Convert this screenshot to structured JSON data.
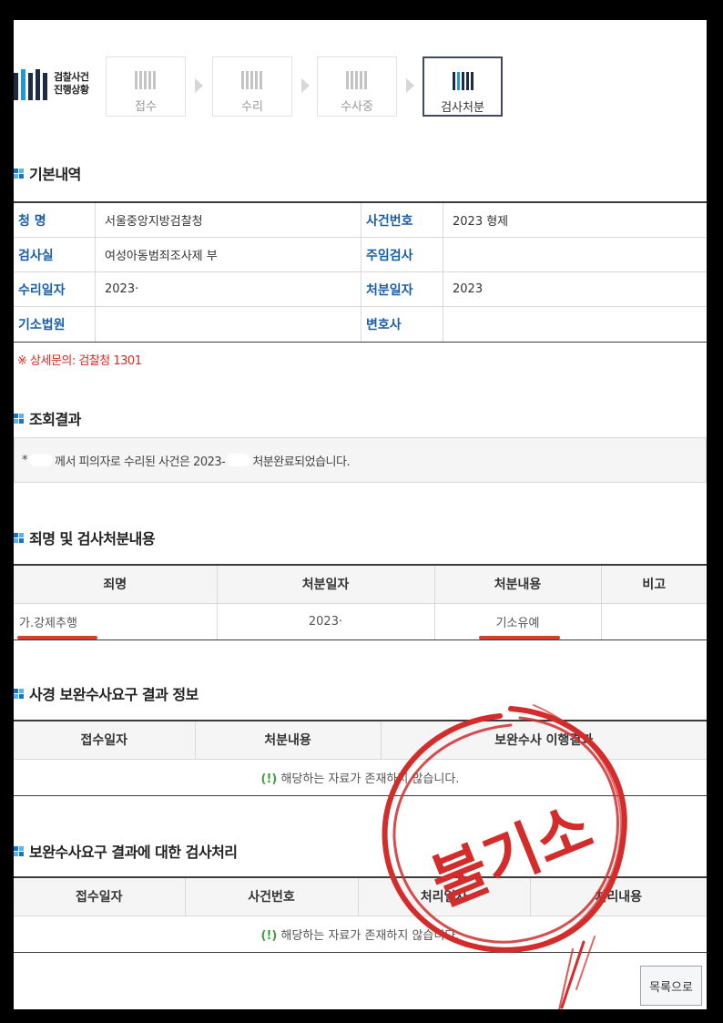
{
  "progress": {
    "logo_line1": "검찰사건",
    "logo_line2": "진행상황",
    "steps": [
      {
        "label": "접수",
        "active": false
      },
      {
        "label": "수리",
        "active": false
      },
      {
        "label": "수사중",
        "active": false
      },
      {
        "label": "검사처분",
        "active": true
      }
    ]
  },
  "basic": {
    "title": "기본내역",
    "rows": [
      {
        "k1": "청 명",
        "v1": "서울중앙지방검찰청",
        "k2": "사건번호",
        "v2": "2023 형제"
      },
      {
        "k1": "검사실",
        "v1": "여성아동범죄조사제 부",
        "k2": "주임검사",
        "v2": ""
      },
      {
        "k1": "수리일자",
        "v1": "2023·",
        "k2": "처분일자",
        "v2": "2023"
      },
      {
        "k1": "기소법원",
        "v1": "",
        "k2": "변호사",
        "v2": ""
      }
    ],
    "notice": "※ 상세문의: 검찰청 1301"
  },
  "inquiry": {
    "title": "조회결과",
    "prefix": "*",
    "text_a": "께서 피의자로 수리된 사건은 2023-",
    "text_b": "처분완료되었습니다."
  },
  "charges": {
    "title": "죄명 및 검사처분내용",
    "headers": [
      "죄명",
      "처분일자",
      "처분내용",
      "비고"
    ],
    "row": {
      "charge": "가.강제추행",
      "date": "2023·",
      "disposition": "기소유예",
      "note": ""
    }
  },
  "police": {
    "title": "사경 보완수사요구 결과 정보",
    "headers": [
      "접수일자",
      "처분내용",
      "보완수사 이행결과"
    ],
    "empty_mark": "(!)",
    "empty_text": "해당하는 자료가 존재하지 않습니다."
  },
  "prosecutor": {
    "title": "보완수사요구 결과에 대한 검사처리",
    "headers": [
      "접수일자",
      "사건번호",
      "처리일자",
      "처리내용"
    ],
    "empty_mark": "(!)",
    "empty_text": "해당하는 자료가 존재하지 않습니다."
  },
  "list_button": "목록으로",
  "stamp": {
    "text": "불기소",
    "color": "#d42b2b"
  },
  "colors": {
    "label_blue": "#1b5ea8",
    "notice_red": "#e0261f",
    "underline": "#d6402b",
    "empty_green": "#3da23a"
  }
}
